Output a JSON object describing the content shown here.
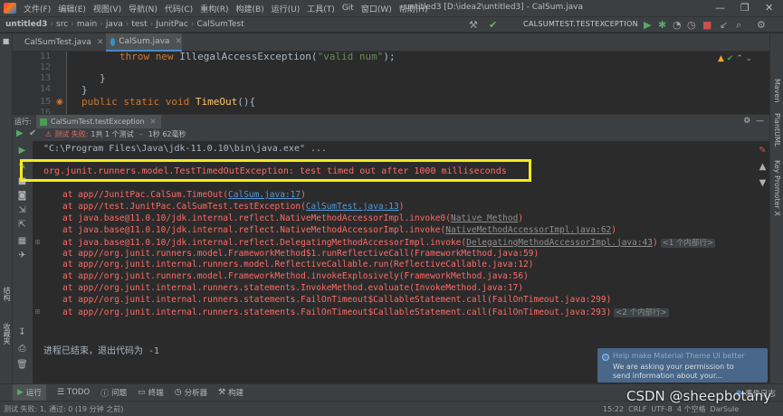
{
  "menubar": {
    "items": [
      "文件(F)",
      "编辑(E)",
      "视图(V)",
      "导航(N)",
      "代码(C)",
      "重构(R)",
      "构建(B)",
      "运行(U)",
      "工具(T)",
      "Git",
      "窗口(W)",
      "帮助(H)"
    ],
    "window_title": "untitled3 [D:\\idea2\\untitled3] - CalSum.java",
    "minimize": "—",
    "restore": "❐",
    "close": "✕"
  },
  "navbar": {
    "crumbs": [
      "untitled3",
      "src",
      "main",
      "java",
      "test",
      "JunitPac",
      "CalSumTest"
    ],
    "run_config": "CALSUMTEST.TESTEXCEPTION"
  },
  "tabs": [
    {
      "label": "CalSumTest.java",
      "active": false
    },
    {
      "label": "CalSum.java",
      "active": true
    }
  ],
  "editor": {
    "lines": [
      {
        "num": "11"
      },
      {
        "num": "12"
      },
      {
        "num": "13"
      },
      {
        "num": "14"
      },
      {
        "num": "15"
      },
      {
        "num": "16"
      }
    ],
    "code": {
      "throw_kw": "throw new ",
      "throw_rest": "IllegalAccessException(",
      "throw_str": "\"valid num\"",
      "throw_end": ");",
      "brace1": "}",
      "brace2": "}",
      "sig_kw": "public static void ",
      "sig_name": "TimeOut",
      "sig_end": "(){"
    }
  },
  "run_panel": {
    "header_label": "运行:",
    "tab_label": "CalSumTest.testException",
    "status_fail": "测试 失败:",
    "status_count": "1共 1 个测试",
    "status_time": "1秒 62毫秒"
  },
  "console": {
    "command": "\"C:\\Program Files\\Java\\jdk-11.0.10\\bin\\java.exe\" ...",
    "error": "org.junit.runners.model.TestTimedOutException: test timed out after 1000 milliseconds",
    "stack": [
      {
        "prefix": "at app//JunitPac.CalSum.TimeOut(",
        "link": "CalSum.java:17",
        "suffix": ")",
        "style": "link"
      },
      {
        "prefix": "at app//test.JunitPac.CalSumTest.testException(",
        "link": "CalSumTest.java:13",
        "suffix": ")",
        "style": "link"
      },
      {
        "prefix": "at java.base@11.0.10/jdk.internal.reflect.NativeMethodAccessorImpl.invoke0(",
        "link": "Native Method",
        "suffix": ")",
        "style": "grey"
      },
      {
        "prefix": "at java.base@11.0.10/jdk.internal.reflect.NativeMethodAccessorImpl.invoke(",
        "link": "NativeMethodAccessorImpl.java:62",
        "suffix": ")",
        "style": "grey"
      },
      {
        "prefix": "at java.base@11.0.10/jdk.internal.reflect.DelegatingMethodAccessorImpl.invoke(",
        "link": "DelegatingMethodAccessorImpl.java:43",
        "suffix": ")",
        "style": "grey",
        "folded": "<1 个内部行>"
      },
      {
        "prefix": "at app//org.junit.runners.model.FrameworkMethod$1.runReflectiveCall(",
        "link": "FrameworkMethod.java:59",
        "suffix": ")",
        "style": "plain"
      },
      {
        "prefix": "at app//org.junit.internal.runners.model.ReflectiveCallable.run(",
        "link": "ReflectiveCallable.java:12",
        "suffix": ")",
        "style": "plain"
      },
      {
        "prefix": "at app//org.junit.runners.model.FrameworkMethod.invokeExplosively(",
        "link": "FrameworkMethod.java:56",
        "suffix": ")",
        "style": "plain"
      },
      {
        "prefix": "at app//org.junit.internal.runners.statements.InvokeMethod.evaluate(",
        "link": "InvokeMethod.java:17",
        "suffix": ")",
        "style": "plain"
      },
      {
        "prefix": "at app//org.junit.internal.runners.statements.FailOnTimeout$CallableStatement.call(",
        "link": "FailOnTimeout.java:299",
        "suffix": ")",
        "style": "plain"
      },
      {
        "prefix": "at app//org.junit.internal.runners.statements.FailOnTimeout$CallableStatement.call(",
        "link": "FailOnTimeout.java:293",
        "suffix": ")",
        "style": "plain",
        "folded": "<2 个内部行>"
      }
    ],
    "exit": "进程已结束，退出代码为 -1"
  },
  "notification": {
    "title": "Help make Material Theme UI better",
    "body_line1": "We are asking your permission to",
    "body_line2": "send information about your..."
  },
  "bottom_tools": [
    "运行",
    "TODO",
    "问题",
    "终端",
    "分析器",
    "构建"
  ],
  "bottom_right": "事件日志",
  "status": {
    "left": "测试 失败: 1, 通过: 0 (19 分钟 之前)",
    "right": "15:22  CRLF  UTF-8  4 个空格  DarSule"
  },
  "right_strip": [
    "Maven",
    "PlantUML",
    "Key Promoter X"
  ],
  "left_strip": [
    "结构",
    "收藏夹"
  ],
  "watermark": "CSDN @sheepbotany",
  "colors": {
    "highlight_box": "#f5eb1a",
    "error": "#ff6b68",
    "link": "#5897d6"
  }
}
